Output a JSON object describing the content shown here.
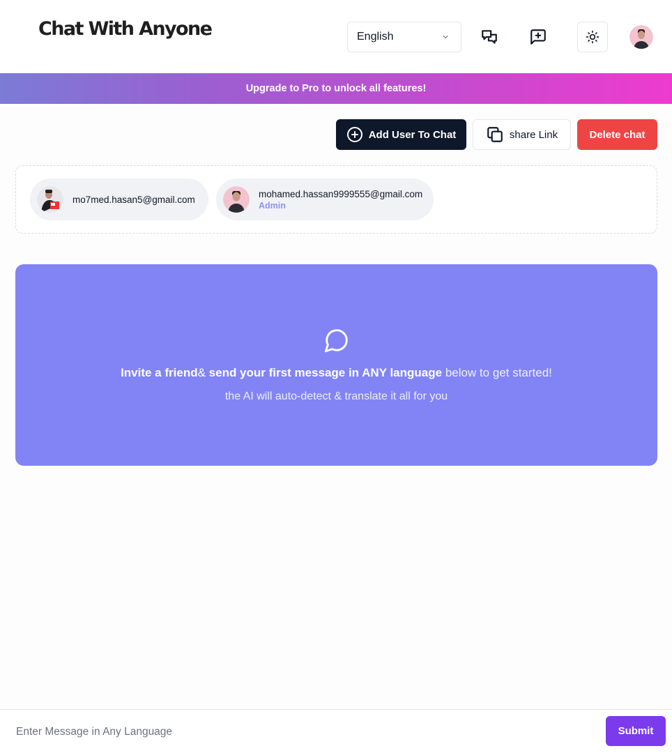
{
  "header": {
    "logo": "Chat With Anyone",
    "language": {
      "selected": "English"
    }
  },
  "banner": {
    "text": "Upgrade to Pro to unlock all features!"
  },
  "actions": {
    "add_user": "Add User To Chat",
    "share_link": "share Link",
    "delete_chat": "Delete chat"
  },
  "users": [
    {
      "email": "mo7med.hasan5@gmail.com",
      "role": ""
    },
    {
      "email": "mohamed.hassan9999555@gmail.com",
      "role": "Admin"
    }
  ],
  "empty_state": {
    "bold1": "Invite a friend",
    "amp": "& ",
    "bold2": "send your first message in ANY language",
    "rest": " below to get started!",
    "line2": "the AI will auto-detect & translate it all for you"
  },
  "composer": {
    "placeholder": "Enter Message in Any Language",
    "value": "",
    "submit": "Submit"
  },
  "colors": {
    "primary_dark": "#0f172a",
    "danger": "#ef4444",
    "hero_bg": "#8284f5",
    "submit": "#7c3aed",
    "admin_label": "#8b93f4"
  },
  "icons": {
    "chats": "chats-icon",
    "new_chat": "message-plus-icon",
    "theme": "sun-icon",
    "add": "plus-circle-icon",
    "copy": "copy-icon",
    "dropdown": "chevron-down-icon",
    "hero": "message-circle-icon"
  }
}
